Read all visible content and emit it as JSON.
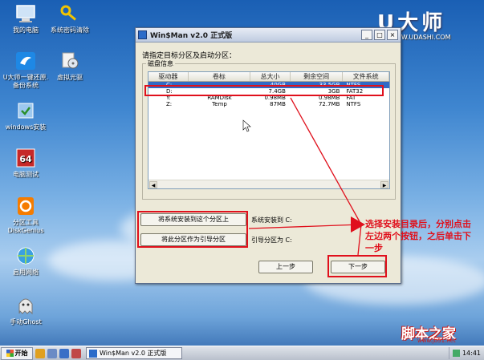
{
  "desktop": {
    "icons": [
      {
        "label": "我的电脑"
      },
      {
        "label": "系统密码清除"
      },
      {
        "label": "U大师一键还原.备份系统"
      },
      {
        "label": "虚拟光驱"
      },
      {
        "label": "windows安装"
      },
      {
        "label": "电脑测试"
      },
      {
        "label": "分区工具 DiskGenius"
      },
      {
        "label": "启用网络"
      },
      {
        "label": "手动Ghost"
      }
    ],
    "brand": "U大师",
    "brand_url": "WWW.UDASHI.COM"
  },
  "window": {
    "title": "Win$Man v2.0 正式版",
    "prompt": "请指定目标分区及启动分区：",
    "group_label": "磁盘信息",
    "columns": [
      "驱动器",
      "卷标",
      "总大小",
      "剩余空间",
      "文件系统"
    ],
    "rows": [
      {
        "drive": "C:",
        "label": "",
        "total": "40GB",
        "free": "33.5GB",
        "fs": "NTFS"
      },
      {
        "drive": "D:",
        "label": "",
        "total": "7.4GB",
        "free": "3GB",
        "fs": "FAT32"
      },
      {
        "drive": "Y:",
        "label": "RAMDisk",
        "total": "0.98MB",
        "free": "0.98MB",
        "fs": "FAT"
      },
      {
        "drive": "Z:",
        "label": "Temp",
        "total": "87MB",
        "free": "72.7MB",
        "fs": "NTFS"
      }
    ],
    "install_button": "将系统安装到这个分区上",
    "install_status": "系统安装到  C:",
    "boot_button": "将此分区作为引导分区",
    "boot_status": "引导分区为  C:",
    "prev_button": "上一步",
    "next_button": "下一步"
  },
  "annotation": {
    "text": "选择安装目录后，分别点击左边两个按钮，之后单击下一步"
  },
  "taskbar": {
    "start_label": "开始",
    "task_title": "Win$Man v2.0 正式版",
    "clock": "14:41"
  },
  "watermark": {
    "site": "脚本之家",
    "url": "www.jb51.net"
  },
  "colors": {
    "accent_red": "#e0101c",
    "selection": "#316ac5"
  }
}
